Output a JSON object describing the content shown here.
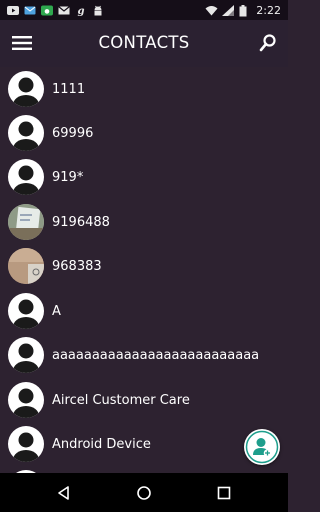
{
  "status_bar": {
    "time": "2:22",
    "left_icons": [
      "youtube-icon",
      "email-icon",
      "hangouts-icon",
      "gmail-icon",
      "g-icon",
      "android-icon"
    ],
    "right_icons": [
      "wifi-icon",
      "signal-icon",
      "battery-icon"
    ]
  },
  "app_bar": {
    "title": "CONTACTS",
    "menu_icon": "hamburger-menu-icon",
    "search_icon": "search-icon"
  },
  "contacts": [
    {
      "name": "1111",
      "avatar": "default"
    },
    {
      "name": "69996",
      "avatar": "default"
    },
    {
      "name": "919*",
      "avatar": "default"
    },
    {
      "name": "9196488",
      "avatar": "photo"
    },
    {
      "name": "968383",
      "avatar": "photo"
    },
    {
      "name": "A",
      "avatar": "default"
    },
    {
      "name": "aaaaaaaaaaaaaaaaaaaaaaaaaa",
      "avatar": "default"
    },
    {
      "name": "Aircel Customer Care",
      "avatar": "default"
    },
    {
      "name": "Android Device",
      "avatar": "default"
    }
  ],
  "fab": {
    "icon": "add-contact-icon"
  },
  "nav_bar": {
    "buttons": [
      "back-icon",
      "home-icon",
      "recents-icon"
    ]
  },
  "colors": {
    "background": "#2d2230",
    "status_bar": "#150e18",
    "accent": "#1e9e8c",
    "text": "#ffffff"
  }
}
